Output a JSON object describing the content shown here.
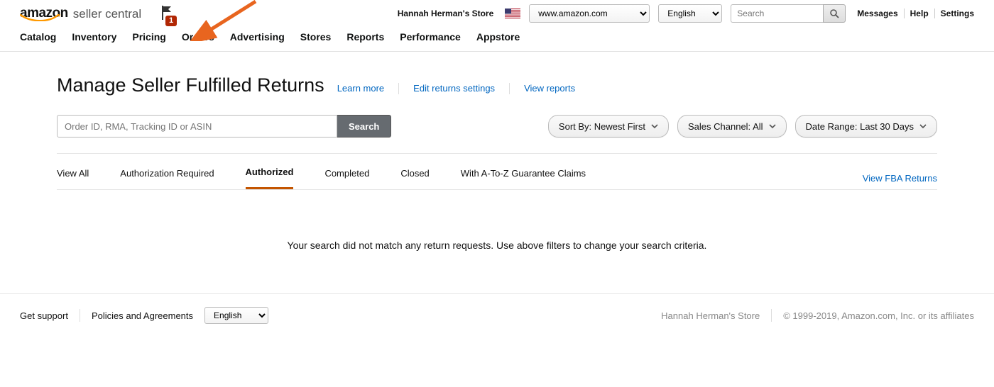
{
  "header": {
    "logo_amazon": "amazon",
    "logo_sc": "seller central",
    "notification_count": "1",
    "store_name": "Hannah Herman's Store",
    "domain_selected": "www.amazon.com",
    "language_selected": "English",
    "search_placeholder": "Search",
    "links": {
      "messages": "Messages",
      "help": "Help",
      "settings": "Settings"
    }
  },
  "nav": {
    "items": [
      "Catalog",
      "Inventory",
      "Pricing",
      "Orders",
      "Advertising",
      "Stores",
      "Reports",
      "Performance",
      "Appstore"
    ]
  },
  "page": {
    "title": "Manage Seller Fulfilled Returns",
    "learn_more": "Learn more",
    "edit_settings": "Edit returns settings",
    "view_reports": "View reports",
    "search_placeholder": "Order ID, RMA, Tracking ID or ASIN",
    "search_button": "Search",
    "sort_label": "Sort By: Newest First",
    "channel_label": "Sales Channel: All",
    "daterange_label": "Date Range: Last 30 Days",
    "tabs": {
      "view_all": "View All",
      "auth_required": "Authorization Required",
      "authorized": "Authorized",
      "completed": "Completed",
      "closed": "Closed",
      "a_to_z": "With A-To-Z Guarantee Claims"
    },
    "fba_link": "View FBA Returns",
    "empty": "Your search did not match any return requests. Use above filters to change your search criteria."
  },
  "footer": {
    "support": "Get support",
    "policies": "Policies and Agreements",
    "language_selected": "English",
    "store_name": "Hannah Herman's Store",
    "copyright": "© 1999-2019, Amazon.com, Inc. or its affiliates"
  }
}
